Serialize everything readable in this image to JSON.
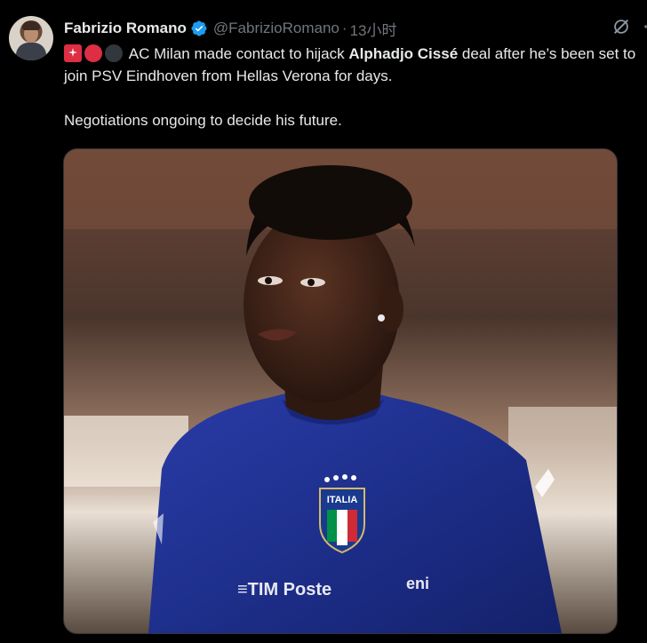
{
  "tweet": {
    "author_name": "Fabrizio Romano",
    "handle": "@FabrizioRomano",
    "separator": "·",
    "time": "13小时",
    "text_before_bold": " AC Milan made contact to hijack ",
    "bold_name": "Alphadjo Cissé",
    "text_after_bold": " deal after he’s been set to join PSV Eindhoven from Hellas Verona for days.",
    "paragraph2": "Negotiations ongoing to decide his future.",
    "emojis": [
      "siren-emoji",
      "red-circle-emoji",
      "black-circle-emoji"
    ]
  },
  "media": {
    "crest_text": "ITALIA",
    "sponsor_text": "≡TIM Poste",
    "sponsor_text2": "eni"
  },
  "icons": {
    "verified": "verified-badge-icon",
    "grok": "grok-icon",
    "more": "more-icon"
  },
  "colors": {
    "background": "#000000",
    "text": "#e7e9ea",
    "muted": "#71767b",
    "verified_blue": "#1d9bf0",
    "jersey": "#1e2f8c"
  }
}
